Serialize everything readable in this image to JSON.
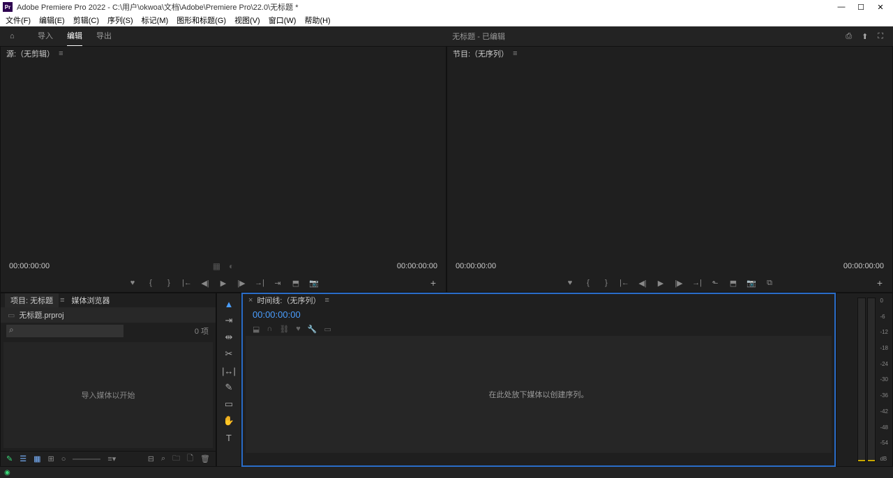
{
  "titleBar": {
    "logo": "Pr",
    "title": "Adobe Premiere Pro 2022 - C:\\用户\\okwoa\\文档\\Adobe\\Premiere Pro\\22.0\\无标题 *"
  },
  "menu": [
    "文件(F)",
    "编辑(E)",
    "剪辑(C)",
    "序列(S)",
    "标记(M)",
    "图形和标题(G)",
    "视图(V)",
    "窗口(W)",
    "帮助(H)"
  ],
  "workspace": {
    "tabs": [
      "导入",
      "编辑",
      "导出"
    ],
    "activeIndex": 1,
    "center": "无标题 - 已编辑"
  },
  "sourcePanel": {
    "title": "源:（无剪辑）",
    "tcLeft": "00:00:00:00",
    "tcRight": "00:00:00:00"
  },
  "programPanel": {
    "title": "节目:（无序列）",
    "tcLeft": "00:00:00:00",
    "tcRight": "00:00:00:00"
  },
  "project": {
    "tabs": [
      "项目: 无标题",
      "媒体浏览器"
    ],
    "activeIndex": 0,
    "fileName": "无标题.prproj",
    "itemCount": "0 项",
    "emptyMsg": "导入媒体以开始"
  },
  "timeline": {
    "title": "时间线:（无序列）",
    "tc": "00:00:00:00",
    "emptyMsg": "在此处放下媒体以创建序列。"
  },
  "meterScale": [
    "0",
    "-6",
    "-12",
    "-18",
    "-24",
    "-30",
    "-36",
    "-42",
    "-48",
    "-54",
    "dB"
  ],
  "toolNames": [
    "selection-tool",
    "track-select-tool",
    "ripple-edit-tool",
    "razor-tool",
    "slip-tool",
    "pen-tool",
    "rectangle-tool",
    "hand-tool",
    "type-tool"
  ]
}
